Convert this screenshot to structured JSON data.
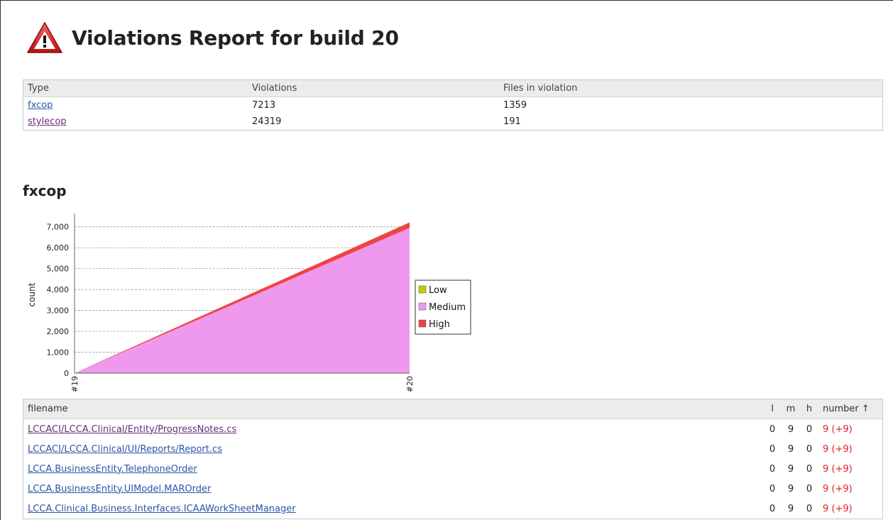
{
  "page": {
    "title": "Violations Report for build 20"
  },
  "summary": {
    "headers": [
      "Type",
      "Violations",
      "Files in violation"
    ],
    "rows": [
      {
        "type": "fxcop",
        "violations": "7213",
        "files": "1359"
      },
      {
        "type": "stylecop",
        "violations": "24319",
        "files": "191"
      }
    ]
  },
  "section": {
    "title": "fxcop"
  },
  "chart_data": {
    "type": "area",
    "x": [
      "#19",
      "#20"
    ],
    "ylabel": "count",
    "ylim": [
      0,
      7500
    ],
    "yticks": [
      "0",
      "1,000",
      "2,000",
      "3,000",
      "4,000",
      "5,000",
      "6,000",
      "7,000"
    ],
    "stacked": true,
    "series": [
      {
        "name": "Low",
        "values": [
          0,
          0
        ],
        "color": "#c8c80a"
      },
      {
        "name": "Medium",
        "values": [
          0,
          6950
        ],
        "color": "#ee99ee"
      },
      {
        "name": "High",
        "values": [
          0,
          263
        ],
        "color": "#ee4444"
      }
    ],
    "grid": true,
    "legend": "right"
  },
  "files_table": {
    "headers": {
      "filename": "filename",
      "l": "l",
      "m": "m",
      "h": "h",
      "number": "number ↑"
    },
    "rows": [
      {
        "filename": "LCCACI/LCCA.Clinical/Entity/ProgressNotes.cs",
        "l": "0",
        "m": "9",
        "h": "0",
        "number": "9 (+9)"
      },
      {
        "filename": "LCCACI/LCCA.Clinical/UI/Reports/Report.cs",
        "l": "0",
        "m": "9",
        "h": "0",
        "number": "9 (+9)"
      },
      {
        "filename": "LCCA.BusinessEntity.TelephoneOrder",
        "l": "0",
        "m": "9",
        "h": "0",
        "number": "9 (+9)"
      },
      {
        "filename": "LCCA.BusinessEntity.UIModel.MAROrder",
        "l": "0",
        "m": "9",
        "h": "0",
        "number": "9 (+9)"
      },
      {
        "filename": "LCCA.Clinical.Business.Interfaces.ICAAWorkSheetManager",
        "l": "0",
        "m": "9",
        "h": "0",
        "number": "9 (+9)"
      }
    ]
  }
}
